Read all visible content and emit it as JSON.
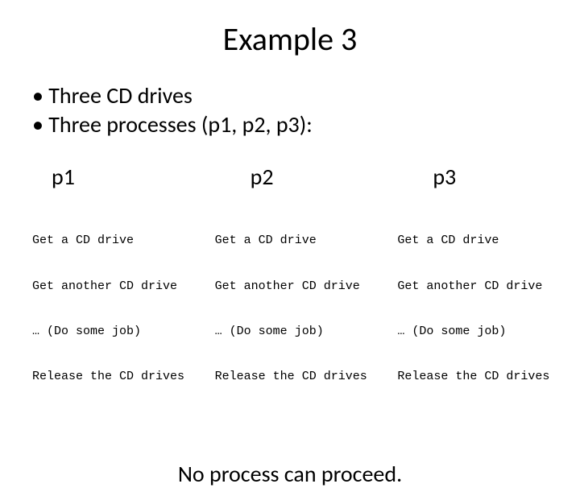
{
  "title": "Example 3",
  "bullets": [
    "Three CD drives",
    "Three processes (p1, p2, p3):"
  ],
  "columns": [
    {
      "heading": "p1",
      "lines": [
        "Get a CD drive",
        "Get another CD drive",
        "… (Do some job)",
        "Release the CD drives"
      ]
    },
    {
      "heading": "p2",
      "lines": [
        "Get a CD drive",
        "Get another CD drive",
        "… (Do some job)",
        "Release the CD drives"
      ]
    },
    {
      "heading": "p3",
      "lines": [
        "Get a CD drive",
        "Get another CD drive",
        "… (Do some job)",
        "Release the CD drives"
      ]
    }
  ],
  "conclusion": "No process can proceed."
}
